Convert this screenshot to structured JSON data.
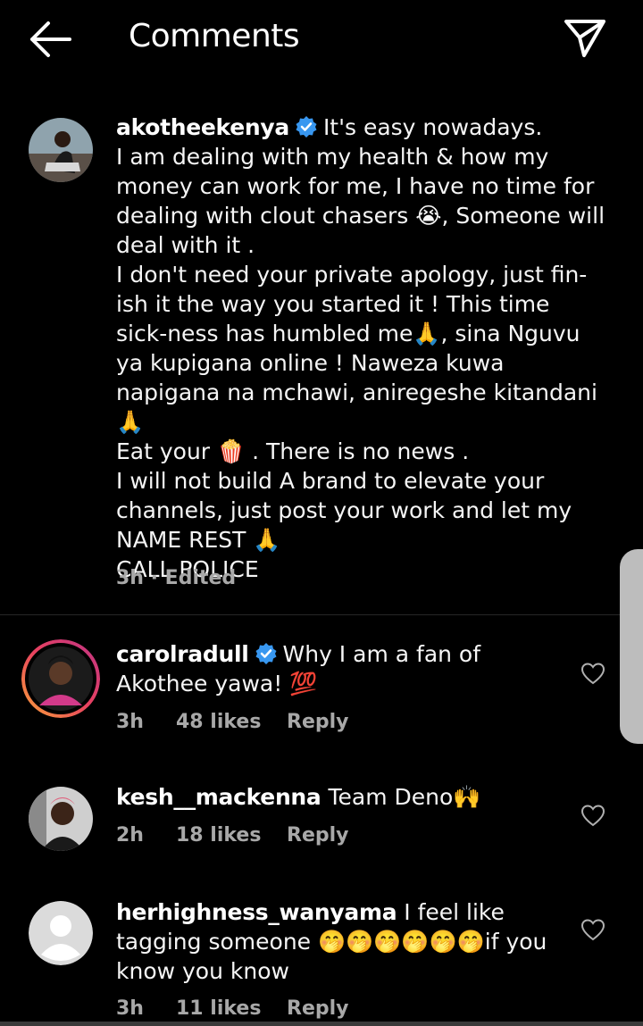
{
  "header": {
    "title": "Comments",
    "back_icon": "arrow-left-icon",
    "share_icon": "paper-plane-icon"
  },
  "caption": {
    "username": "akotheekenya",
    "text": "It's easy nowadays.\nI am dealing with my health & how my money can work for me, I have no time for dealing with  clout chasers 😭, Someone will deal with it .\nI don't need your private apology,  just fin-ish it the way you started it ! This time sick-ness has humbled me🙏, sina Nguvu ya kupigana online ! Naweza kuwa napigana na mchawi, aniregeshe kitandani 🙏\nEat your 🍿  . There is no news .\nI will not build A brand to elevate your channels, just post your work and let my NAME REST 🙏\nCALL POLICE",
    "time": "3h",
    "edited": "Edited"
  },
  "comments": [
    {
      "username": "carolradull",
      "verified": true,
      "text": "Why I am a fan of Akothee yawa! 💯",
      "time": "3h",
      "likes": "48 likes",
      "reply": "Reply"
    },
    {
      "username": "kesh__mackenna",
      "verified": false,
      "text": "Team Deno🙌",
      "time": "2h",
      "likes": "18 likes",
      "reply": "Reply"
    },
    {
      "username": "herhighness_wanyama",
      "verified": false,
      "text": "I feel like tagging someone 🤭🤭🤭🤭🤭🤭if you know you know",
      "time": "3h",
      "likes": "11 likes",
      "reply": "Reply"
    }
  ],
  "colors": {
    "background": "#000000",
    "text": "#f5f5f5",
    "meta": "#a8a8a8",
    "verified": "#3897f0",
    "divider": "#262626"
  }
}
